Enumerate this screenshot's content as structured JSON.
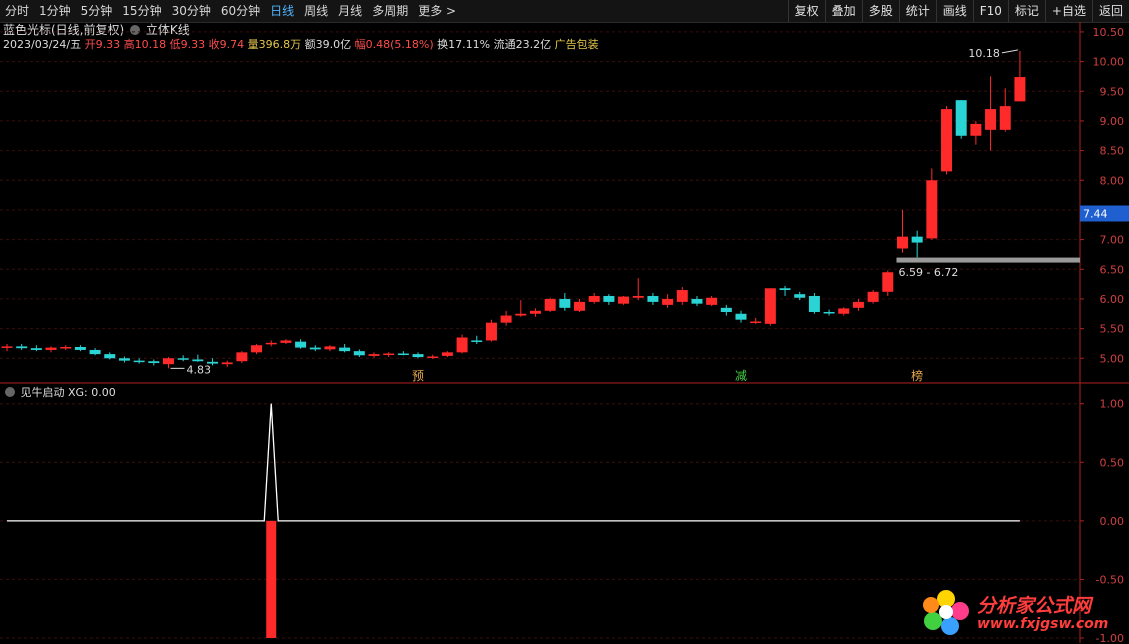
{
  "toolbar": {
    "tabs": [
      "分时",
      "1分钟",
      "5分钟",
      "15分钟",
      "30分钟",
      "60分钟",
      "日线",
      "周线",
      "月线",
      "多周期",
      "更多 >"
    ],
    "active_tab": "日线",
    "actions": [
      "复权",
      "叠加",
      "多股",
      "统计",
      "画线",
      "F10",
      "标记",
      "+自选",
      "返回"
    ]
  },
  "legend": {
    "stock_name": "蓝色光标(日线,前复权)",
    "view_mode": "立体K线",
    "date": "2023/03/24/五",
    "open_label": "开",
    "open": "9.33",
    "high_label": "高",
    "high": "10.18",
    "low_label": "低",
    "low": "9.33",
    "close_label": "收",
    "close": "9.74",
    "volume_label": "量",
    "volume": "396.8万",
    "amount_label": "额",
    "amount": "39.0亿",
    "change_label": "幅",
    "change": "0.48(5.18%)",
    "turnover_label": "换",
    "turnover": "17.11%",
    "float_label": "流通",
    "float": "23.2亿",
    "industry": "广告包装"
  },
  "indicator": {
    "name": "见牛启动",
    "label": "XG: 0.00"
  },
  "watermark": {
    "line1": "分析家公式网",
    "line2": "www.fxjgsw.com"
  },
  "colors": {
    "up": "#ff2a2a",
    "down": "#2ad4d4",
    "bg": "#000000",
    "grid": "#3a0e0e",
    "axis": "#b02020"
  },
  "chart_data": [
    {
      "type": "candlestick",
      "ylim": [
        4.6,
        10.6
      ],
      "yticks": [
        5.0,
        5.5,
        6.0,
        6.5,
        7.0,
        7.5,
        8.0,
        8.5,
        9.0,
        9.5,
        10.0,
        10.5
      ],
      "current_price": "7.44",
      "current_price_value": 7.44,
      "annotations": {
        "high": "10.18",
        "low": "4.83",
        "range": "6.59 - 6.72",
        "range_low": 6.59,
        "range_high": 6.72
      },
      "event_labels": [
        {
          "text": "预",
          "index": 28,
          "color": "#e6a84a"
        },
        {
          "text": "减",
          "index": 50,
          "color": "#41d141"
        },
        {
          "text": "榜",
          "index": 62,
          "color": "#e6a84a"
        }
      ],
      "ohlc": [
        [
          5.18,
          5.24,
          5.12,
          5.2
        ],
        [
          5.2,
          5.24,
          5.14,
          5.17
        ],
        [
          5.17,
          5.22,
          5.12,
          5.14
        ],
        [
          5.14,
          5.2,
          5.1,
          5.18
        ],
        [
          5.18,
          5.22,
          5.14,
          5.19
        ],
        [
          5.19,
          5.22,
          5.12,
          5.14
        ],
        [
          5.14,
          5.17,
          5.05,
          5.07
        ],
        [
          5.07,
          5.1,
          4.98,
          5.0
        ],
        [
          5.0,
          5.03,
          4.93,
          4.96
        ],
        [
          4.96,
          5.0,
          4.91,
          4.95
        ],
        [
          4.95,
          4.98,
          4.88,
          4.92
        ],
        [
          4.9,
          5.02,
          4.83,
          5.0
        ],
        [
          5.0,
          5.05,
          4.95,
          4.98
        ],
        [
          4.98,
          5.06,
          4.94,
          4.95
        ],
        [
          4.94,
          5.0,
          4.88,
          4.91
        ],
        [
          4.9,
          4.96,
          4.85,
          4.93
        ],
        [
          4.95,
          5.12,
          4.92,
          5.1
        ],
        [
          5.1,
          5.24,
          5.07,
          5.22
        ],
        [
          5.24,
          5.3,
          5.2,
          5.26
        ],
        [
          5.26,
          5.32,
          5.24,
          5.3
        ],
        [
          5.28,
          5.32,
          5.16,
          5.18
        ],
        [
          5.18,
          5.22,
          5.12,
          5.15
        ],
        [
          5.15,
          5.22,
          5.12,
          5.2
        ],
        [
          5.18,
          5.24,
          5.1,
          5.12
        ],
        [
          5.12,
          5.15,
          5.02,
          5.05
        ],
        [
          5.04,
          5.1,
          5.01,
          5.07
        ],
        [
          5.06,
          5.1,
          5.02,
          5.08
        ],
        [
          5.08,
          5.12,
          5.05,
          5.07
        ],
        [
          5.07,
          5.1,
          5.0,
          5.02
        ],
        [
          5.02,
          5.06,
          4.99,
          5.03
        ],
        [
          5.04,
          5.12,
          5.02,
          5.1
        ],
        [
          5.1,
          5.4,
          5.08,
          5.35
        ],
        [
          5.3,
          5.38,
          5.24,
          5.28
        ],
        [
          5.3,
          5.65,
          5.28,
          5.6
        ],
        [
          5.6,
          5.8,
          5.55,
          5.72
        ],
        [
          5.72,
          5.98,
          5.7,
          5.75
        ],
        [
          5.75,
          5.84,
          5.7,
          5.8
        ],
        [
          5.8,
          6.02,
          5.78,
          6.0
        ],
        [
          6.0,
          6.1,
          5.8,
          5.85
        ],
        [
          5.8,
          6.0,
          5.78,
          5.95
        ],
        [
          5.95,
          6.1,
          5.92,
          6.05
        ],
        [
          6.05,
          6.08,
          5.9,
          5.95
        ],
        [
          5.92,
          6.05,
          5.9,
          6.04
        ],
        [
          6.02,
          6.35,
          5.98,
          6.05
        ],
        [
          6.05,
          6.1,
          5.9,
          5.95
        ],
        [
          5.9,
          6.08,
          5.85,
          6.0
        ],
        [
          5.95,
          6.2,
          5.9,
          6.15
        ],
        [
          6.0,
          6.05,
          5.88,
          5.92
        ],
        [
          5.9,
          6.05,
          5.88,
          6.02
        ],
        [
          5.85,
          5.9,
          5.72,
          5.78
        ],
        [
          5.75,
          5.8,
          5.6,
          5.65
        ],
        [
          5.6,
          5.68,
          5.58,
          5.62
        ],
        [
          5.58,
          6.18,
          5.55,
          6.18
        ],
        [
          6.18,
          6.22,
          6.05,
          6.15
        ],
        [
          6.08,
          6.12,
          5.98,
          6.02
        ],
        [
          6.05,
          6.1,
          5.75,
          5.78
        ],
        [
          5.78,
          5.82,
          5.72,
          5.76
        ],
        [
          5.75,
          5.86,
          5.72,
          5.84
        ],
        [
          5.85,
          6.0,
          5.8,
          5.95
        ],
        [
          5.95,
          6.15,
          5.92,
          6.12
        ],
        [
          6.12,
          6.48,
          6.05,
          6.45
        ],
        [
          6.85,
          7.5,
          6.78,
          7.05
        ],
        [
          7.05,
          7.15,
          6.7,
          6.95
        ],
        [
          7.02,
          8.2,
          7.0,
          8.0
        ],
        [
          8.15,
          9.25,
          8.1,
          9.2
        ],
        [
          9.35,
          9.35,
          8.7,
          8.75
        ],
        [
          8.75,
          9.0,
          8.6,
          8.95
        ],
        [
          8.85,
          9.75,
          8.5,
          9.2
        ],
        [
          8.85,
          9.55,
          8.82,
          9.25
        ],
        [
          9.33,
          10.18,
          9.33,
          9.74
        ]
      ]
    },
    {
      "type": "line",
      "series": [
        {
          "values": [
            0,
            0,
            0,
            0,
            0,
            0,
            0,
            0,
            0,
            0,
            0,
            0,
            0,
            0,
            0,
            0,
            0,
            0,
            1,
            0,
            0,
            0,
            0,
            0,
            0,
            0,
            0,
            0,
            0,
            0,
            0,
            0,
            0,
            0,
            0,
            0,
            0,
            0,
            0,
            0,
            0,
            0,
            0,
            0,
            0,
            0,
            0,
            0,
            0,
            0,
            0,
            0,
            0,
            0,
            0,
            0,
            0,
            0,
            0,
            0,
            0,
            0,
            0,
            0,
            0,
            0,
            0,
            0,
            0,
            0
          ]
        }
      ],
      "bar_signal_index": 18,
      "ylim": [
        -1.0,
        1.1
      ],
      "yticks": [
        1.0,
        0.5,
        0.0,
        -0.5,
        -1.0
      ],
      "ytick_labels": [
        "1.00",
        "0.50",
        "0.00",
        "-0.50",
        "-1.00"
      ]
    }
  ]
}
